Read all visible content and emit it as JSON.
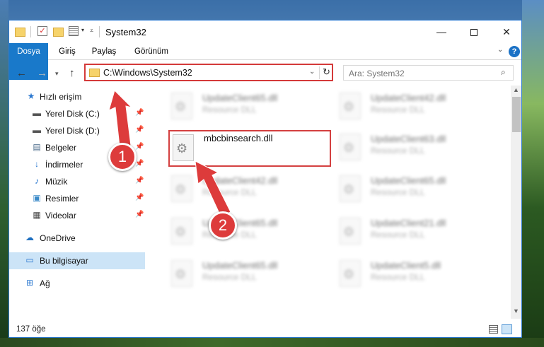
{
  "window": {
    "title": "System32"
  },
  "title_buttons": {
    "minimize": "—",
    "maximize": "",
    "close": "✕"
  },
  "ribbon": {
    "tabs": [
      "Dosya",
      "Giriş",
      "Paylaş",
      "Görünüm"
    ],
    "help": "?"
  },
  "address": {
    "path": "C:\\Windows\\System32"
  },
  "search": {
    "placeholder": "Ara: System32"
  },
  "sidebar": {
    "items": [
      {
        "label": "Hızlı erişim",
        "icon": "star-icon",
        "pinned": false
      },
      {
        "label": "Yerel Disk (C:)",
        "icon": "drive-icon",
        "pinned": true
      },
      {
        "label": "Yerel Disk (D:)",
        "icon": "drive-icon",
        "pinned": true
      },
      {
        "label": "Belgeler",
        "icon": "document-icon",
        "pinned": true
      },
      {
        "label": "İndirmeler",
        "icon": "download-icon",
        "pinned": true
      },
      {
        "label": "Müzik",
        "icon": "music-icon",
        "pinned": true
      },
      {
        "label": "Resimler",
        "icon": "picture-icon",
        "pinned": true
      },
      {
        "label": "Videolar",
        "icon": "video-icon",
        "pinned": true
      },
      {
        "label": "OneDrive",
        "icon": "cloud-icon",
        "pinned": false
      },
      {
        "label": "Bu bilgisayar",
        "icon": "computer-icon",
        "pinned": false,
        "selected": true
      },
      {
        "label": "Ağ",
        "icon": "network-icon",
        "pinned": false
      }
    ]
  },
  "files": [
    {
      "name": "UpdateClient65.dll",
      "type": "Resource DLL",
      "blurred": true
    },
    {
      "name": "UpdateClient42.dll",
      "type": "Resource DLL",
      "blurred": true
    },
    {
      "name": "mbcbinsearch.dll",
      "type": "",
      "blurred": false,
      "highlighted": true
    },
    {
      "name": "UpdateClient63.dll",
      "type": "Resource DLL",
      "blurred": true
    },
    {
      "name": "UpdateClient42.dll",
      "type": "Resource DLL",
      "blurred": true
    },
    {
      "name": "UpdateClient65.dll",
      "type": "Resource DLL",
      "blurred": true
    },
    {
      "name": "UpdateClient65.dll",
      "type": "Resource DLL",
      "blurred": true
    },
    {
      "name": "UpdateClient21.dll",
      "type": "Resource DLL",
      "blurred": true
    },
    {
      "name": "UpdateClient65.dll",
      "type": "Resource DLL",
      "blurred": true
    },
    {
      "name": "UpdateClient5.dll",
      "type": "Resource DLL",
      "blurred": true
    }
  ],
  "status": {
    "item_count": "137 öğe"
  },
  "annotations": {
    "step1": "1",
    "step2": "2",
    "color": "#dd3b3b"
  },
  "colors": {
    "accent": "#1979ca",
    "highlight": "#d43a3a",
    "selected_bg": "#cce4f7"
  }
}
